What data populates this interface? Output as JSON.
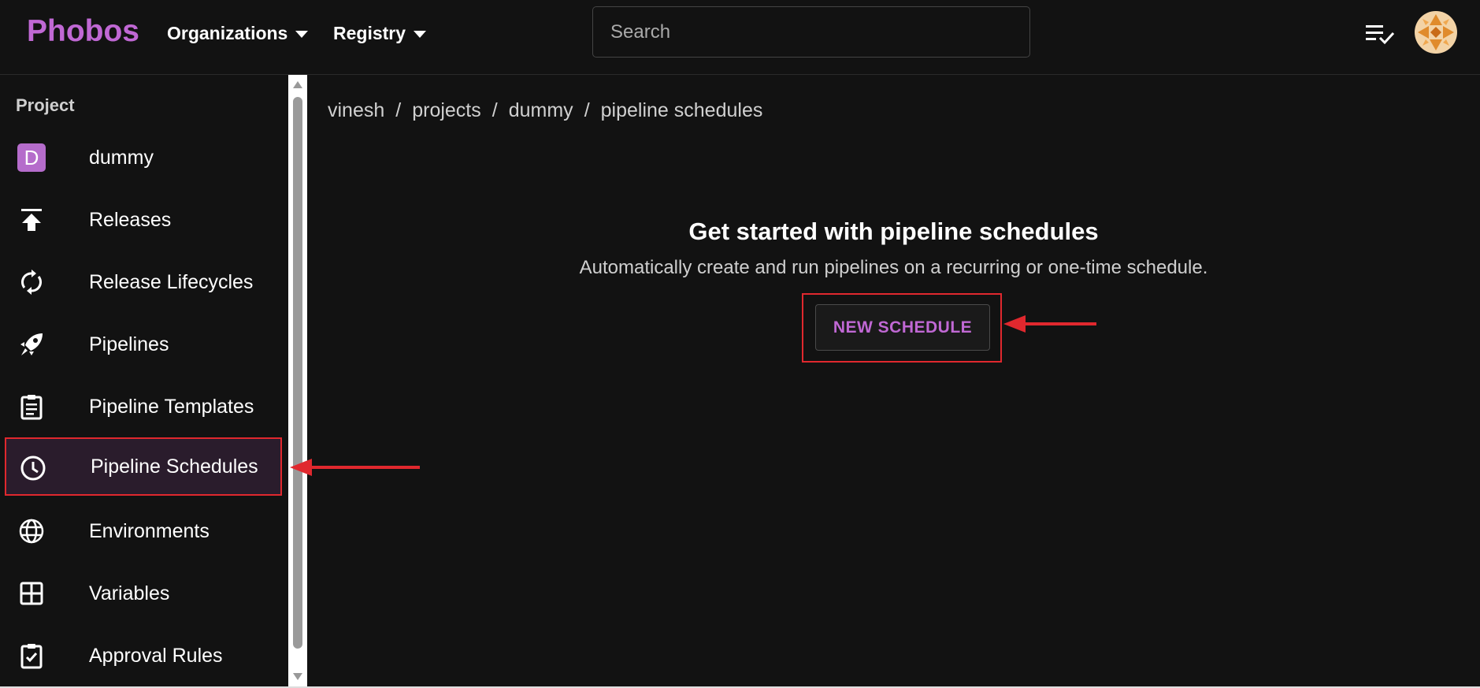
{
  "header": {
    "brand": "Phobos",
    "menus": [
      {
        "label": "Organizations"
      },
      {
        "label": "Registry"
      }
    ],
    "search": {
      "placeholder": "Search",
      "value": ""
    }
  },
  "sidebar": {
    "section_label": "Project",
    "project_badge": "D",
    "items": [
      {
        "label": "dummy",
        "icon": "project-badge"
      },
      {
        "label": "Releases",
        "icon": "upload-icon"
      },
      {
        "label": "Release Lifecycles",
        "icon": "sync-icon"
      },
      {
        "label": "Pipelines",
        "icon": "rocket-icon"
      },
      {
        "label": "Pipeline Templates",
        "icon": "clipboard-icon"
      },
      {
        "label": "Pipeline Schedules",
        "icon": "clock-icon",
        "active": true
      },
      {
        "label": "Environments",
        "icon": "globe-icon"
      },
      {
        "label": "Variables",
        "icon": "grid-icon"
      },
      {
        "label": "Approval Rules",
        "icon": "checklist-icon"
      }
    ]
  },
  "breadcrumb": [
    "vinesh",
    "projects",
    "dummy",
    "pipeline schedules"
  ],
  "breadcrumb_separator": "/",
  "empty_state": {
    "title": "Get started with pipeline schedules",
    "description": "Automatically create and run pipelines on a recurring or one-time schedule.",
    "button_label": "NEW SCHEDULE"
  },
  "colors": {
    "brand": "#c068d4",
    "annotation": "#e0282e",
    "background": "#121212",
    "active_item": "#2a1c2c"
  }
}
